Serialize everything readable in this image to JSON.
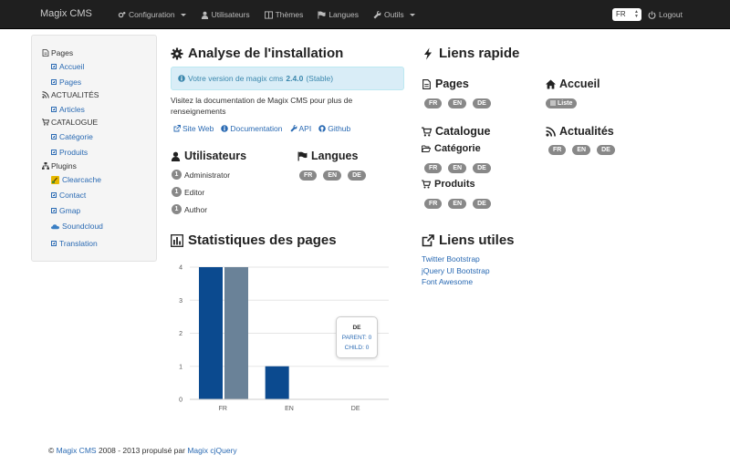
{
  "navbar": {
    "brand": "Magix CMS",
    "items": [
      {
        "label": "Configuration",
        "icon": "gears-icon",
        "dropdown": true
      },
      {
        "label": "Utilisateurs",
        "icon": "user-icon",
        "dropdown": false
      },
      {
        "label": "Thèmes",
        "icon": "columns-icon",
        "dropdown": false
      },
      {
        "label": "Langues",
        "icon": "flag-icon",
        "dropdown": false
      },
      {
        "label": "Outils",
        "icon": "wrench-icon",
        "dropdown": true
      }
    ],
    "language": "FR",
    "logout": "Logout"
  },
  "sidebar": {
    "pages": {
      "label": "Pages",
      "items": [
        "Accueil",
        "Pages"
      ]
    },
    "news": {
      "label": "ACTUALITÉS",
      "items": [
        "Articles"
      ]
    },
    "catalog": {
      "label": "CATALOGUE",
      "items": [
        "Catégorie",
        "Produits"
      ]
    },
    "plugins": {
      "label": "Plugins",
      "items": [
        "Clearcache",
        "Contact",
        "Gmap",
        "Soundcloud",
        "Translation"
      ]
    }
  },
  "install": {
    "title": "Analyse de l'installation",
    "alert_prefix": "Votre version de magix cms",
    "version": "2.4.0",
    "status": "(Stable)",
    "doc_text": "Visitez la documentation de Magix CMS pour plus de renseignements",
    "links": [
      "Site Web",
      "Documentation",
      "API",
      "Github"
    ]
  },
  "users": {
    "title": "Utilisateurs",
    "rows": [
      {
        "count": "1",
        "label": "Administrator"
      },
      {
        "count": "1",
        "label": "Editor"
      },
      {
        "count": "1",
        "label": "Author"
      }
    ]
  },
  "languages": {
    "title": "Langues",
    "codes": [
      "FR",
      "EN",
      "DE"
    ]
  },
  "quick_links": {
    "title": "Liens rapide",
    "pages": {
      "title": "Pages",
      "codes": [
        "FR",
        "EN",
        "DE"
      ]
    },
    "home": {
      "title": "Accueil",
      "badge": "Liste"
    },
    "catalog": {
      "title": "Catalogue"
    },
    "category": {
      "title": "Catégorie",
      "codes": [
        "FR",
        "EN",
        "DE"
      ]
    },
    "products": {
      "title": "Produits",
      "codes": [
        "FR",
        "EN",
        "DE"
      ]
    },
    "news": {
      "title": "Actualités",
      "codes": [
        "FR",
        "EN",
        "DE"
      ]
    }
  },
  "useful_links": {
    "title": "Liens utiles",
    "items": [
      "Twitter Bootstrap",
      "jQuery UI Bootstrap",
      "Font Awesome"
    ]
  },
  "stats": {
    "title": "Statistiques des pages"
  },
  "chart_data": {
    "type": "bar",
    "title": "",
    "xlabel": "",
    "ylabel": "",
    "categories": [
      "FR",
      "EN",
      "DE"
    ],
    "series": [
      {
        "name": "PARENT",
        "values": [
          4,
          1,
          0
        ],
        "color": "#0b4a8f"
      },
      {
        "name": "CHILD",
        "values": [
          4,
          0,
          0
        ],
        "color": "#6a8298"
      }
    ],
    "ylim": [
      0,
      4
    ],
    "yticks": [
      "0",
      "1",
      "2",
      "3",
      "4"
    ],
    "grid": true,
    "tooltip": {
      "title": "DE",
      "lines": [
        "PARENT: 0",
        "CHILD: 0"
      ]
    }
  },
  "footer": {
    "copyright": "©",
    "brand": "Magix CMS",
    "text": "2008 - 2013 propulsé par",
    "link": "Magix cjQuery"
  }
}
